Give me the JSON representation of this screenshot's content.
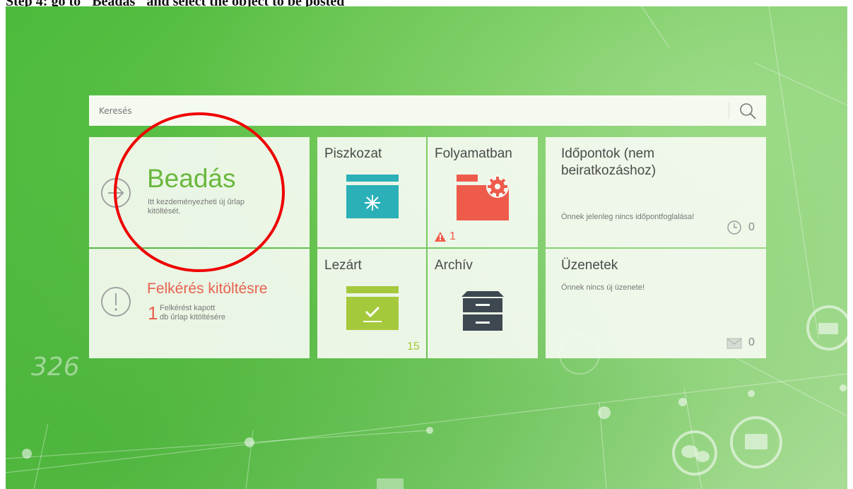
{
  "caption": "Step 4: go to \"Beadás\" and select the object to be posted",
  "search": {
    "placeholder": "Keresés",
    "icon": "search-icon"
  },
  "colors": {
    "green_title": "#6ab83e",
    "red_title": "#e8614e",
    "teal_folder": "#2bb0b8",
    "red_folder": "#ef5b4b",
    "lime_folder": "#a5c93c",
    "archive_gray": "#3d4851"
  },
  "tiles": {
    "beadas": {
      "title": "Beadás",
      "desc_line1": "Itt kezdeményezheti új űrlap",
      "desc_line2": "kitöltését.",
      "icon": "arrow-right-circle-icon",
      "annotation": "red-circle-highlight"
    },
    "felkeres": {
      "title": "Felkérés kitöltésre",
      "count": "1",
      "desc_line1": "Felkérést kapott",
      "desc_line2": "db űrlap kitöltésére",
      "icon": "exclamation-circle-icon"
    },
    "piszkozat": {
      "title": "Piszkozat",
      "icon": "draft-folder-icon"
    },
    "folyamatban": {
      "title": "Folyamatban",
      "icon": "gear-folder-icon",
      "warning_count": "1",
      "warning_icon": "warning-icon"
    },
    "lezart": {
      "title": "Lezárt",
      "icon": "check-folder-icon",
      "count": "15"
    },
    "archiv": {
      "title": "Archív",
      "icon": "archive-cabinet-icon"
    },
    "idopontok": {
      "title_line1": "Időpontok (nem",
      "title_line2": "beiratkozáshoz)",
      "desc": "Önnek jelenleg nincs időpontfoglalása!",
      "count": "0",
      "icon": "clock-icon"
    },
    "uzenetek": {
      "title": "Üzenetek",
      "desc": "Önnek nincs új üzenete!",
      "count": "0",
      "icon": "envelope-icon"
    }
  },
  "background_number": "326"
}
